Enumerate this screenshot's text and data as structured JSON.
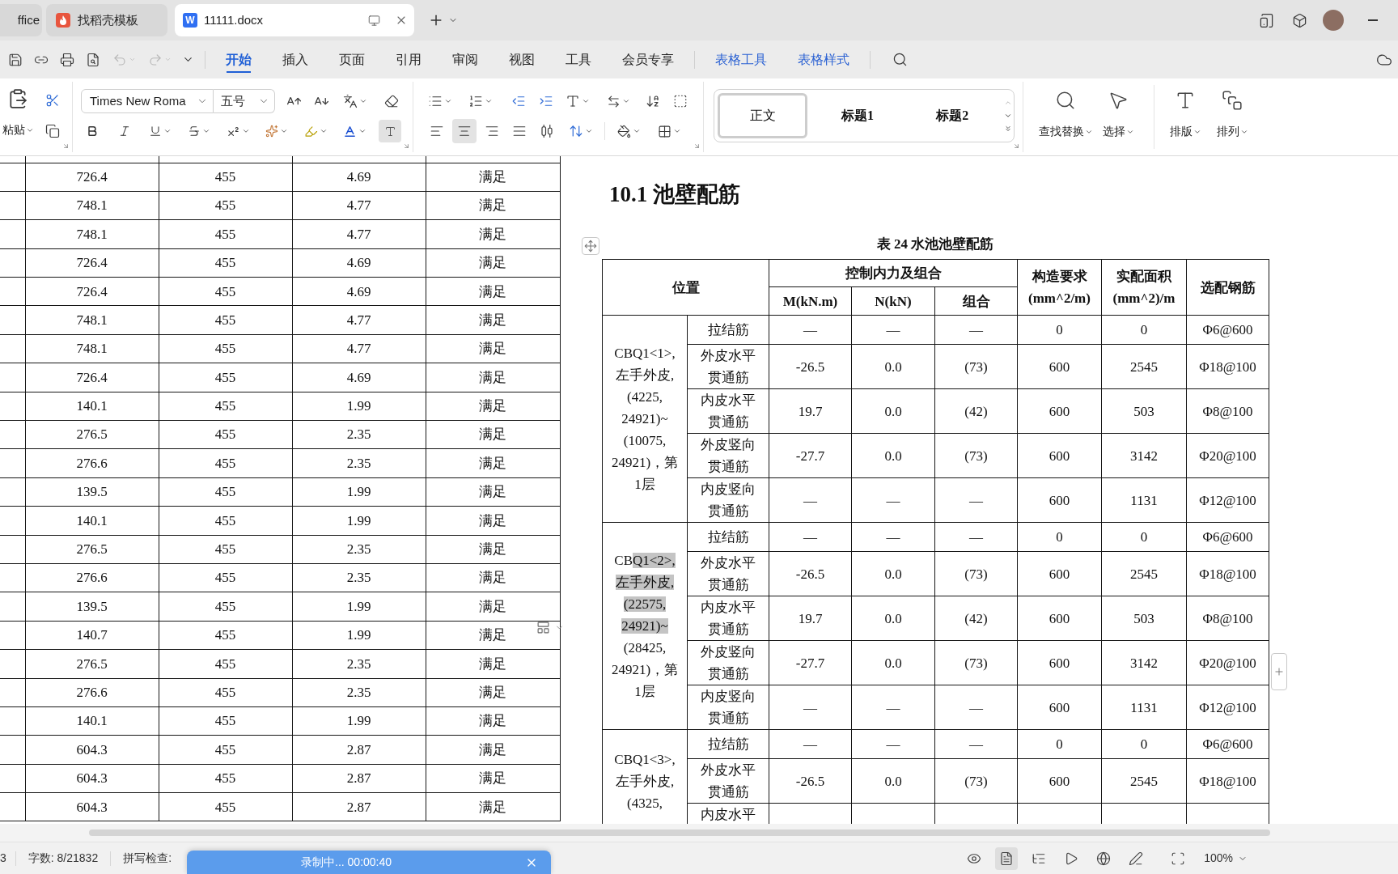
{
  "tabs": [
    {
      "label": "ffice",
      "kind": "cut",
      "selected": false
    },
    {
      "label": "找稻壳模板",
      "kind": "docer",
      "selected": false
    },
    {
      "label": "11111.docx",
      "kind": "writer",
      "icon_text": "W",
      "selected": true
    }
  ],
  "quick_access": {
    "undo_disabled": true,
    "redo_disabled": true
  },
  "menu": [
    {
      "label": "开始",
      "kind": "main",
      "selected": true
    },
    {
      "label": "插入",
      "kind": "main",
      "selected": false
    },
    {
      "label": "页面",
      "kind": "main",
      "selected": false
    },
    {
      "label": "引用",
      "kind": "main",
      "selected": false
    },
    {
      "label": "审阅",
      "kind": "main",
      "selected": false
    },
    {
      "label": "视图",
      "kind": "main",
      "selected": false
    },
    {
      "label": "工具",
      "kind": "main",
      "selected": false
    },
    {
      "label": "会员专享",
      "kind": "main",
      "selected": false
    },
    {
      "label": "表格工具",
      "kind": "context",
      "selected": false
    },
    {
      "label": "表格样式",
      "kind": "context",
      "selected": false
    }
  ],
  "ribbon": {
    "paste": "粘贴",
    "font_name": "Times New Roma",
    "font_size": "五号",
    "align": [
      {
        "kind": "left",
        "selected": false
      },
      {
        "kind": "center",
        "selected": true
      },
      {
        "kind": "right",
        "selected": false
      },
      {
        "kind": "justify",
        "selected": false
      },
      {
        "kind": "distribute",
        "selected": false
      }
    ],
    "styles": [
      {
        "label": "正文",
        "kind": "body",
        "selected": true
      },
      {
        "label": "标题1",
        "kind": "heading",
        "selected": false
      },
      {
        "label": "标题2",
        "kind": "heading",
        "selected": false
      }
    ],
    "tools": [
      {
        "label": "查找替换",
        "kind": "find"
      },
      {
        "label": "选择",
        "kind": "select"
      },
      {
        "label": "排版",
        "kind": "layout"
      },
      {
        "label": "排列",
        "kind": "arrange"
      }
    ]
  },
  "left_table": {
    "rows": [
      [
        "726.4",
        "455",
        "4.69",
        "满足"
      ],
      [
        "748.1",
        "455",
        "4.77",
        "满足"
      ],
      [
        "748.1",
        "455",
        "4.77",
        "满足"
      ],
      [
        "726.4",
        "455",
        "4.69",
        "满足"
      ],
      [
        "726.4",
        "455",
        "4.69",
        "满足"
      ],
      [
        "748.1",
        "455",
        "4.77",
        "满足"
      ],
      [
        "748.1",
        "455",
        "4.77",
        "满足"
      ],
      [
        "726.4",
        "455",
        "4.69",
        "满足"
      ],
      [
        "140.1",
        "455",
        "1.99",
        "满足"
      ],
      [
        "276.5",
        "455",
        "2.35",
        "满足"
      ],
      [
        "276.6",
        "455",
        "2.35",
        "满足"
      ],
      [
        "139.5",
        "455",
        "1.99",
        "满足"
      ],
      [
        "140.1",
        "455",
        "1.99",
        "满足"
      ],
      [
        "276.5",
        "455",
        "2.35",
        "满足"
      ],
      [
        "276.6",
        "455",
        "2.35",
        "满足"
      ],
      [
        "139.5",
        "455",
        "1.99",
        "满足"
      ],
      [
        "140.7",
        "455",
        "1.99",
        "满足"
      ],
      [
        "276.5",
        "455",
        "2.35",
        "满足"
      ],
      [
        "276.6",
        "455",
        "2.35",
        "满足"
      ],
      [
        "140.1",
        "455",
        "1.99",
        "满足"
      ],
      [
        "604.3",
        "455",
        "2.87",
        "满足"
      ],
      [
        "604.3",
        "455",
        "2.87",
        "满足"
      ],
      [
        "604.3",
        "455",
        "2.87",
        "满足"
      ]
    ]
  },
  "heading": "10.1 池壁配筋",
  "caption": "表 24 水池池壁配筋",
  "right_table": {
    "header": {
      "location": "位置",
      "force_group": "控制内力及组合",
      "force_columns": [
        "M(kN.m)",
        "N(kN)",
        "组合"
      ],
      "columns": [
        "构造要求 (mm^2/m)",
        "实配面积 (mm^2)/m",
        "选配钢筋"
      ]
    },
    "groups": [
      {
        "location": [
          {
            "text": "CBQ1<1>, 左手外皮, (4225, 24921)~ (10075, 24921)，第1层",
            "highlighted": false
          }
        ],
        "rows": [
          {
            "type": "拉结筋",
            "cells": [
              "—",
              "—",
              "—",
              "0",
              "0",
              "Φ6@600"
            ]
          },
          {
            "type": "外皮水平贯通筋",
            "cells": [
              "-26.5",
              "0.0",
              "(73)",
              "600",
              "2545",
              "Φ18@100"
            ]
          },
          {
            "type": "内皮水平贯通筋",
            "cells": [
              "19.7",
              "0.0",
              "(42)",
              "600",
              "503",
              "Φ8@100"
            ]
          },
          {
            "type": "外皮竖向贯通筋",
            "cells": [
              "-27.7",
              "0.0",
              "(73)",
              "600",
              "3142",
              "Φ20@100"
            ]
          },
          {
            "type": "内皮竖向贯通筋",
            "cells": [
              "—",
              "—",
              "—",
              "600",
              "1131",
              "Φ12@100"
            ]
          }
        ]
      },
      {
        "location": [
          {
            "text": "CB",
            "highlighted": false
          },
          {
            "text": "Q1<2>, 左手外皮, (22575, 24921)~",
            "highlighted": true
          },
          {
            "text": " (28425, 24921)，第1层",
            "highlighted": false
          }
        ],
        "rows": [
          {
            "type": "拉结筋",
            "cells": [
              "—",
              "—",
              "—",
              "0",
              "0",
              "Φ6@600"
            ]
          },
          {
            "type": "外皮水平贯通筋",
            "cells": [
              "-26.5",
              "0.0",
              "(73)",
              "600",
              "2545",
              "Φ18@100"
            ]
          },
          {
            "type": "内皮水平贯通筋",
            "cells": [
              "19.7",
              "0.0",
              "(42)",
              "600",
              "503",
              "Φ8@100"
            ]
          },
          {
            "type": "外皮竖向贯通筋",
            "cells": [
              "-27.7",
              "0.0",
              "(73)",
              "600",
              "3142",
              "Φ20@100"
            ]
          },
          {
            "type": "内皮竖向贯通筋",
            "cells": [
              "—",
              "—",
              "—",
              "600",
              "1131",
              "Φ12@100"
            ]
          }
        ]
      },
      {
        "location": [
          {
            "text": "CBQ1<3>, 左手外皮, (4325,",
            "highlighted": false
          }
        ],
        "rows": [
          {
            "type": "拉结筋",
            "cells": [
              "—",
              "—",
              "—",
              "0",
              "0",
              "Φ6@600"
            ]
          },
          {
            "type": "外皮水平贯通筋",
            "cells": [
              "-26.5",
              "0.0",
              "(73)",
              "600",
              "2545",
              "Φ18@100"
            ]
          },
          {
            "type": "内皮水平"
          }
        ]
      }
    ]
  },
  "status_bar": {
    "page": "3",
    "word_count": "字数: 8/21832",
    "spell_check": "拼写检查:",
    "zoom": "100%",
    "views": [
      {
        "kind": "read",
        "selected": false
      },
      {
        "kind": "page",
        "selected": true
      },
      {
        "kind": "outline",
        "selected": false
      },
      {
        "kind": "play",
        "selected": false
      },
      {
        "kind": "web",
        "selected": false
      },
      {
        "kind": "pen",
        "selected": false
      }
    ]
  },
  "recorder": {
    "label": "录制中... 00:00:40"
  }
}
